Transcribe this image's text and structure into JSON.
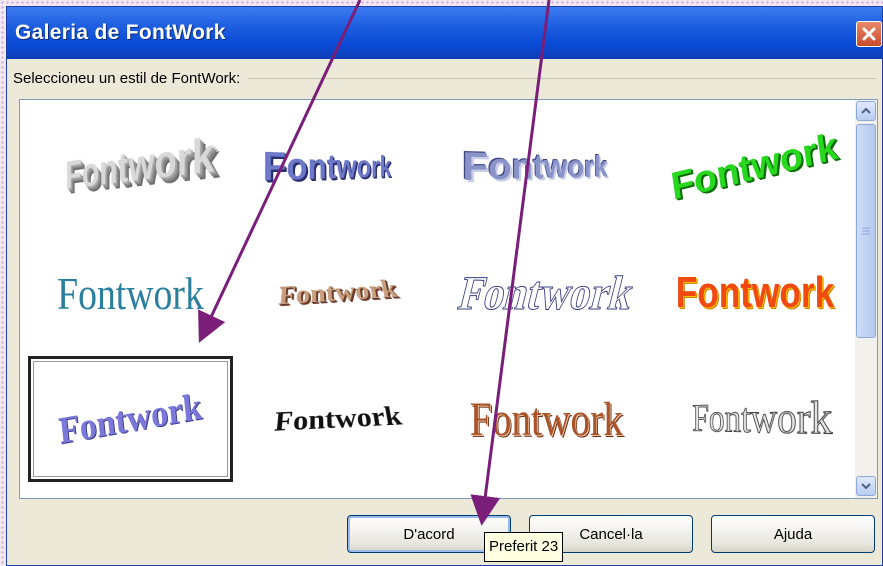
{
  "dialog": {
    "title": "Galeria de FontWork",
    "group_label": "Seleccioneu un estil de FontWork:"
  },
  "gallery": {
    "items": [
      {
        "text": "Fontwork",
        "style": "3D gray extruded"
      },
      {
        "text": "Fontwork",
        "style": "blue perspective"
      },
      {
        "text": "Fontwork",
        "style": "blue-gray shadow"
      },
      {
        "text": "Fontwork",
        "style": "green arch"
      },
      {
        "text": "Fontwork",
        "style": "teal serif"
      },
      {
        "text": "Fontwork",
        "style": "brown arch"
      },
      {
        "text": "Fontwork",
        "style": "outline skew"
      },
      {
        "text": "Fontwork",
        "style": "orange-red gradient"
      },
      {
        "text": "Fontwork",
        "style": "purple wave",
        "selected": true
      },
      {
        "text": "Fontwork",
        "style": "black arch"
      },
      {
        "text": "Fontwork",
        "style": "brown serif"
      },
      {
        "text": "Fontwork",
        "style": "gray outline serif"
      }
    ]
  },
  "buttons": {
    "ok": "D'acord",
    "cancel": "Cancel·la",
    "help": "Ajuda"
  },
  "tooltip": "Preferit 23",
  "colors": {
    "title_bar": "#0a4bd6",
    "annotation_arrow": "#7b1e7a"
  },
  "icons": {
    "close": "close-icon",
    "scroll_up": "chevron-up-icon",
    "scroll_down": "chevron-down-icon"
  }
}
